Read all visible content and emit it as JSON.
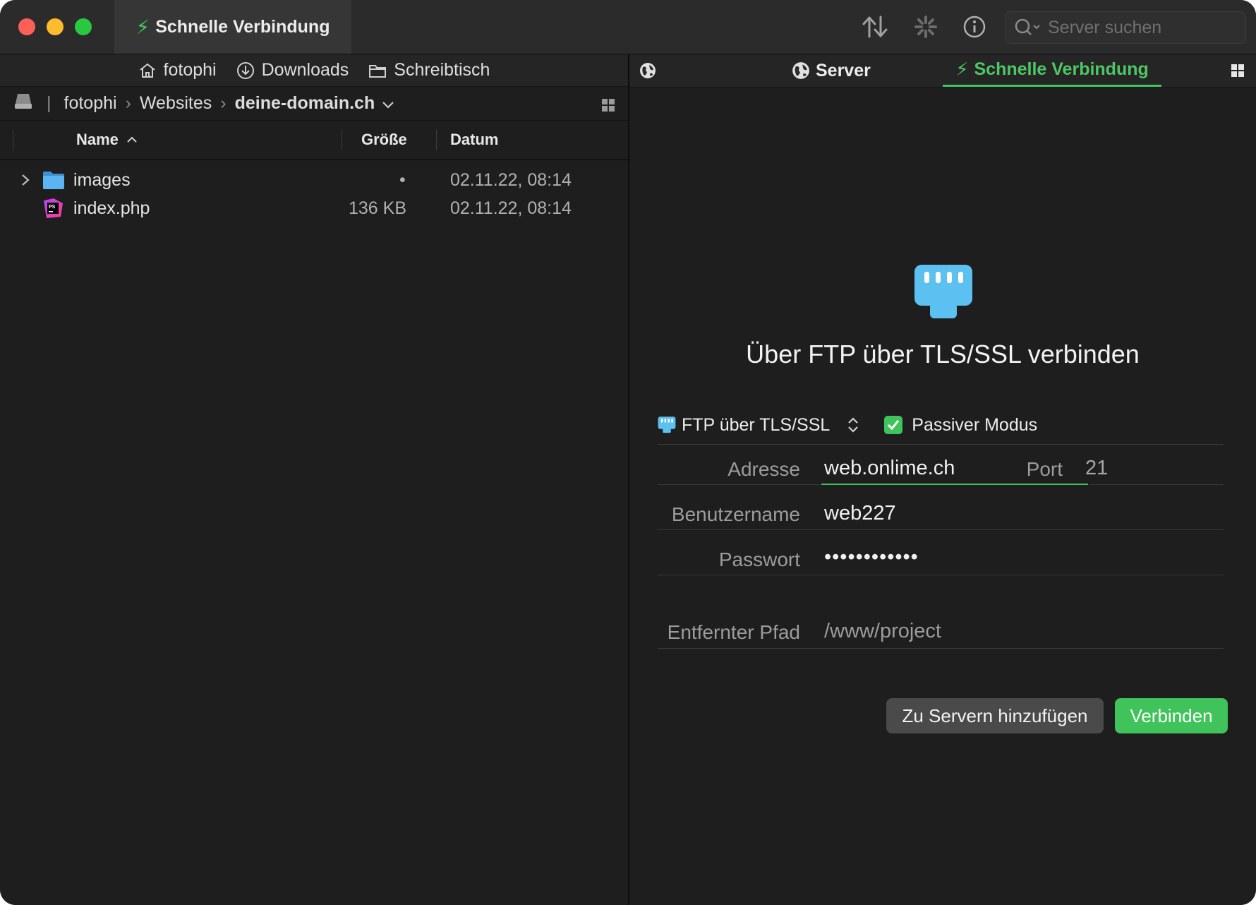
{
  "titlebar": {
    "tab_title": "Schnelle Verbindung",
    "icons": [
      "transfer-arrows-icon",
      "activity-spinner-icon",
      "info-icon"
    ],
    "search_placeholder": "Server suchen"
  },
  "favorites": [
    {
      "label": "fotophi",
      "icon": "home-icon"
    },
    {
      "label": "Downloads",
      "icon": "download-icon"
    },
    {
      "label": "Schreibtisch",
      "icon": "folder-icon"
    }
  ],
  "path": {
    "segments": [
      "fotophi",
      "Websites"
    ],
    "current": "deine-domain.ch"
  },
  "columns": {
    "name": "Name",
    "size": "Größe",
    "date": "Datum"
  },
  "files": [
    {
      "name": "images",
      "size": "•",
      "date": "02.11.22, 08:14",
      "type": "folder"
    },
    {
      "name": "index.php",
      "size": "136 KB",
      "date": "02.11.22, 08:14",
      "type": "php"
    }
  ],
  "right_tabs": {
    "server": "Server",
    "quick": "Schnelle Verbindung"
  },
  "connect": {
    "heading": "Über FTP über TLS/SSL verbinden",
    "protocol": "FTP über TLS/SSL",
    "passive_label": "Passiver Modus",
    "passive_checked": true,
    "address_label": "Adresse",
    "address_value": "web.onlime.ch",
    "port_label": "Port",
    "port_value": "21",
    "user_label": "Benutzername",
    "user_value": "web227",
    "password_label": "Passwort",
    "password_value": "••••••••••••",
    "path_label": "Entfernter Pfad",
    "path_value": "/www/project",
    "add_button": "Zu Servern hinzufügen",
    "connect_button": "Verbinden"
  },
  "colors": {
    "accent": "#3fc35a",
    "folder": "#4aa8ea",
    "plug": "#5cc0f0"
  }
}
